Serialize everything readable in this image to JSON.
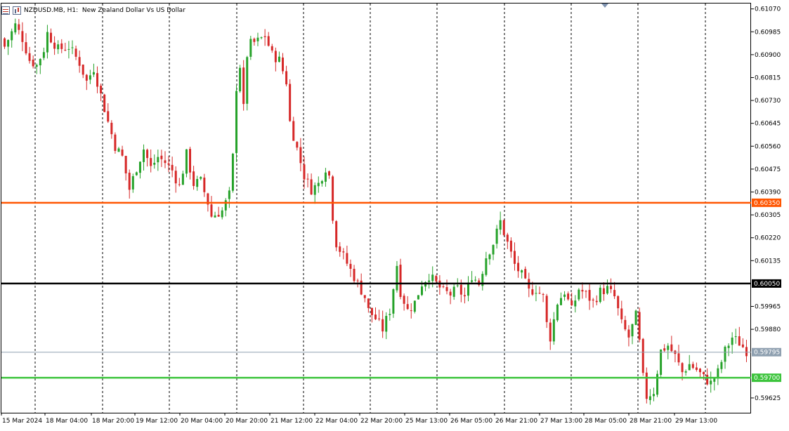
{
  "header": {
    "symbol": "NZDUSD.MB",
    "timeframe": "H1",
    "description": "New Zealand Dollar Vs US Dollar",
    "icons": [
      "table-icon",
      "bar-chart-icon"
    ]
  },
  "colors": {
    "bull": "#26a22a",
    "bear": "#d62828",
    "resistance": "#ff5500",
    "pivot": "#000000",
    "support": "#3cc43c",
    "current": "#8fa0b0"
  },
  "chart_data": {
    "type": "candlestick",
    "ylim": [
      0.5957,
      0.6109
    ],
    "y_ticks": [
      "0.61070",
      "0.60985",
      "0.60900",
      "0.60815",
      "0.60730",
      "0.60645",
      "0.60560",
      "0.60475",
      "0.60390",
      "0.60305",
      "0.60220",
      "0.60135",
      "0.59965",
      "0.59880",
      "0.59625"
    ],
    "x_ticks": [
      "15 Mar 2024",
      "18 Mar 04:00",
      "18 Mar 20:00",
      "19 Mar 12:00",
      "20 Mar 04:00",
      "20 Mar 20:00",
      "21 Mar 12:00",
      "22 Mar 04:00",
      "22 Mar 20:00",
      "25 Mar 13:00",
      "26 Mar 05:00",
      "26 Mar 21:00",
      "27 Mar 13:00",
      "28 Mar 05:00",
      "28 Mar 21:00",
      "29 Mar 13:00"
    ],
    "levels": [
      {
        "label": "0.60350",
        "value": 0.6035,
        "role": "resistance"
      },
      {
        "label": "0.60050",
        "value": 0.6005,
        "role": "pivot"
      },
      {
        "label": "0.59795",
        "value": 0.59795,
        "role": "current"
      },
      {
        "label": "0.59700",
        "value": 0.597,
        "role": "support"
      }
    ],
    "close_path": [
      [
        0,
        0.6093
      ],
      [
        3,
        0.6101
      ],
      [
        5,
        0.6096
      ],
      [
        7,
        0.6088
      ],
      [
        9,
        0.6086
      ],
      [
        11,
        0.6092
      ],
      [
        12,
        0.6098
      ],
      [
        15,
        0.6092
      ],
      [
        18,
        0.6093
      ],
      [
        21,
        0.6087
      ],
      [
        23,
        0.608
      ],
      [
        25,
        0.6085
      ],
      [
        27,
        0.6075
      ],
      [
        29,
        0.6065
      ],
      [
        31,
        0.6056
      ],
      [
        33,
        0.6052
      ],
      [
        35,
        0.604
      ],
      [
        37,
        0.6048
      ],
      [
        39,
        0.6055
      ],
      [
        41,
        0.6048
      ],
      [
        43,
        0.6052
      ],
      [
        45,
        0.605
      ],
      [
        47,
        0.6047
      ],
      [
        49,
        0.6041
      ],
      [
        51,
        0.6053
      ],
      [
        53,
        0.6042
      ],
      [
        55,
        0.6043
      ],
      [
        57,
        0.6035
      ],
      [
        58,
        0.603
      ],
      [
        61,
        0.6032
      ],
      [
        63,
        0.6038
      ],
      [
        64,
        0.6052
      ],
      [
        65,
        0.6078
      ],
      [
        66,
        0.6086
      ],
      [
        67,
        0.607
      ],
      [
        68,
        0.609
      ],
      [
        69,
        0.6094
      ],
      [
        71,
        0.6095
      ],
      [
        73,
        0.6097
      ],
      [
        75,
        0.609
      ],
      [
        77,
        0.6088
      ],
      [
        79,
        0.608
      ],
      [
        80,
        0.6065
      ],
      [
        82,
        0.6055
      ],
      [
        84,
        0.6045
      ],
      [
        86,
        0.604
      ],
      [
        88,
        0.6042
      ],
      [
        90,
        0.6048
      ],
      [
        91,
        0.6045
      ],
      [
        92,
        0.603
      ],
      [
        93,
        0.602
      ],
      [
        95,
        0.6015
      ],
      [
        97,
        0.601
      ],
      [
        99,
        0.6005
      ],
      [
        101,
        0.6
      ],
      [
        102,
        0.5995
      ],
      [
        104,
        0.5992
      ],
      [
        106,
        0.5988
      ],
      [
        108,
        0.5995
      ],
      [
        110,
        0.6012
      ],
      [
        111,
        0.6002
      ],
      [
        113,
        0.5995
      ],
      [
        115,
        0.5998
      ],
      [
        117,
        0.6005
      ],
      [
        119,
        0.6008
      ],
      [
        121,
        0.6005
      ],
      [
        123,
        0.6002
      ],
      [
        125,
        0.6001
      ],
      [
        127,
        0.6003
      ],
      [
        129,
        0.6
      ],
      [
        131,
        0.6008
      ],
      [
        133,
        0.6005
      ],
      [
        135,
        0.6015
      ],
      [
        137,
        0.602
      ],
      [
        139,
        0.6028
      ],
      [
        141,
        0.602
      ],
      [
        143,
        0.6012
      ],
      [
        145,
        0.6008
      ],
      [
        147,
        0.6002
      ],
      [
        149,
        0.6003
      ],
      [
        151,
        0.6
      ],
      [
        152,
        0.599
      ],
      [
        153,
        0.5985
      ],
      [
        155,
        0.5998
      ],
      [
        157,
        0.6002
      ],
      [
        159,
        0.5995
      ],
      [
        161,
        0.6003
      ],
      [
        163,
        0.6001
      ],
      [
        165,
        0.5998
      ],
      [
        167,
        0.6002
      ],
      [
        169,
        0.6003
      ],
      [
        171,
        0.6
      ],
      [
        173,
        0.599
      ],
      [
        175,
        0.5985
      ],
      [
        177,
        0.5993
      ],
      [
        178,
        0.5983
      ],
      [
        179,
        0.597
      ],
      [
        180,
        0.5963
      ],
      [
        182,
        0.5965
      ],
      [
        184,
        0.598
      ],
      [
        186,
        0.5982
      ],
      [
        188,
        0.5978
      ],
      [
        190,
        0.5972
      ],
      [
        192,
        0.5975
      ],
      [
        194,
        0.5973
      ],
      [
        196,
        0.597
      ],
      [
        198,
        0.5968
      ],
      [
        200,
        0.5972
      ],
      [
        202,
        0.598
      ],
      [
        204,
        0.5985
      ],
      [
        206,
        0.5983
      ],
      [
        208,
        0.598
      ]
    ]
  }
}
